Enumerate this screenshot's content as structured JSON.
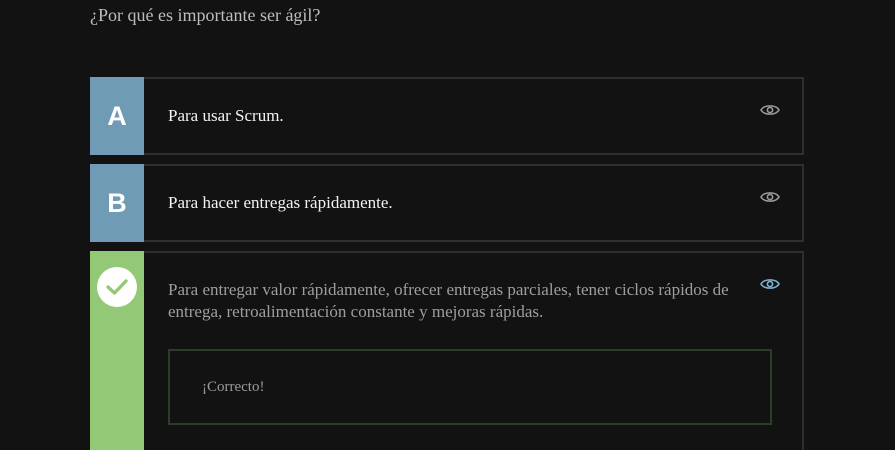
{
  "question": "¿Por qué es importante ser ágil?",
  "options": [
    {
      "letter": "A",
      "text": "Para usar Scrum.",
      "state": "unselected",
      "icon": "eye-icon"
    },
    {
      "letter": "B",
      "text": "Para hacer entregas rápidamente.",
      "state": "unselected",
      "icon": "eye-icon"
    },
    {
      "letter": "",
      "text": "Para entregar valor rápidamente, ofrecer entregas parciales, tener ciclos rápidos de entrega, retroalimentación constante y mejoras rápidas.",
      "state": "correct",
      "icon": "eye-icon",
      "feedback": "¡Correcto!"
    }
  ],
  "colors": {
    "background": "#121212",
    "letter_badge": "#6f9bb5",
    "correct_badge": "#93c976",
    "eye_default": "#9a9a9a",
    "eye_active": "#7fb3d5",
    "feedback_border": "#2c3d2a"
  }
}
